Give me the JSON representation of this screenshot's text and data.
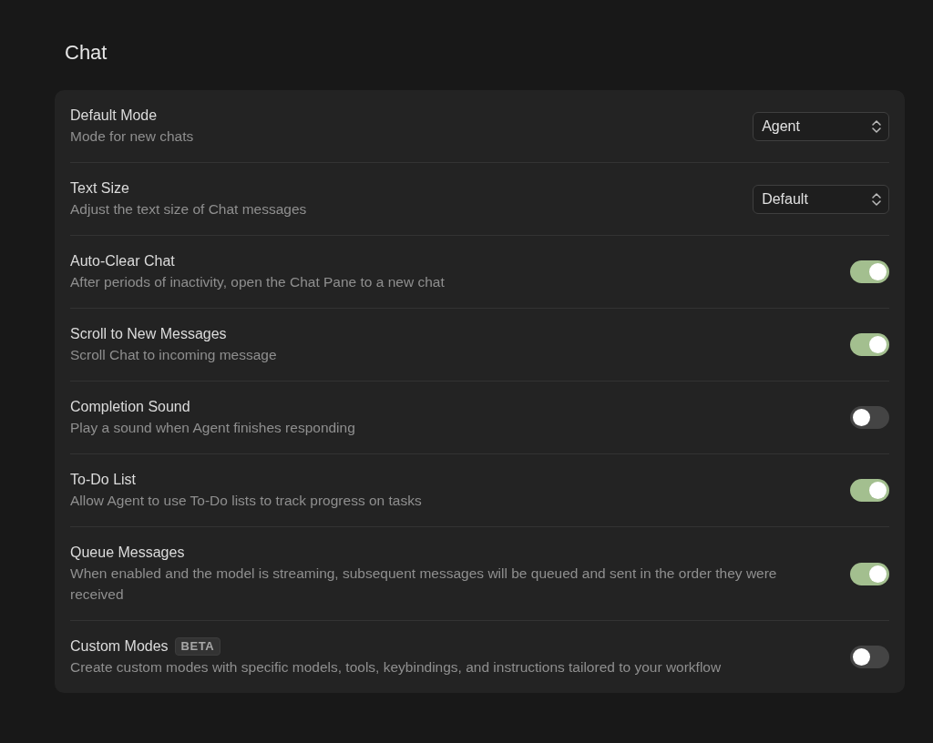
{
  "title": "Chat",
  "settings": [
    {
      "kind": "select",
      "label": "Default Mode",
      "description": "Mode for new chats",
      "value": "Agent"
    },
    {
      "kind": "select",
      "label": "Text Size",
      "description": "Adjust the text size of Chat messages",
      "value": "Default"
    },
    {
      "kind": "toggle",
      "label": "Auto-Clear Chat",
      "description": "After periods of inactivity, open the Chat Pane to a new chat",
      "on": true
    },
    {
      "kind": "toggle",
      "label": "Scroll to New Messages",
      "description": "Scroll Chat to incoming message",
      "on": true
    },
    {
      "kind": "toggle",
      "label": "Completion Sound",
      "description": "Play a sound when Agent finishes responding",
      "on": false
    },
    {
      "kind": "toggle",
      "label": "To-Do List",
      "description": "Allow Agent to use To-Do lists to track progress on tasks",
      "on": true
    },
    {
      "kind": "toggle",
      "label": "Queue Messages",
      "description": "When enabled and the model is streaming, subsequent messages will be queued and sent in the order they were received",
      "on": true
    },
    {
      "kind": "toggle",
      "label": "Custom Modes",
      "badge": "BETA",
      "description": "Create custom modes with specific models, tools, keybindings, and instructions tailored to your workflow",
      "on": false
    }
  ]
}
